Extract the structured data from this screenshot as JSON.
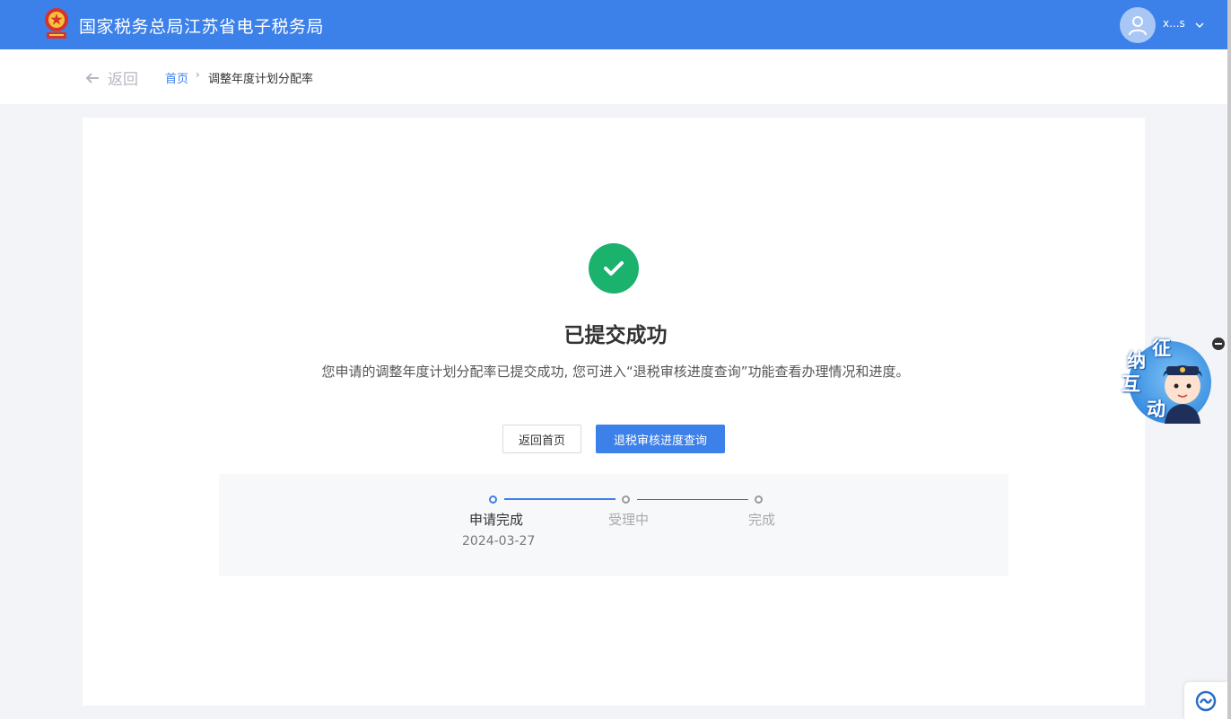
{
  "header": {
    "site_title": "国家税务总局江苏省电子税务局",
    "username": "x...s",
    "emblem_icon": "national-emblem-icon",
    "avatar_icon": "user-avatar-icon",
    "background_color": "#3c80ea"
  },
  "breadcrumb": {
    "back_label": "返回",
    "home_label": "首页",
    "separator": "›",
    "current_label": "调整年度计划分配率"
  },
  "result": {
    "icon": "check-circle-icon",
    "icon_color": "#1bb26d",
    "title": "已提交成功",
    "description": "您申请的调整年度计划分配率已提交成功, 您可进入“退税审核进度查询”功能查看办理情况和进度。"
  },
  "actions": {
    "home_button": "返回首页",
    "query_button": "退税审核进度查询",
    "primary_color": "#3c80ea"
  },
  "steps": [
    {
      "label": "申请完成",
      "date": "2024-03-27",
      "status": "done"
    },
    {
      "label": "受理中",
      "status": "pending"
    },
    {
      "label": "完成",
      "status": "pending"
    }
  ],
  "float_widget": {
    "chars": [
      "征",
      "纳",
      "互",
      "动"
    ]
  }
}
